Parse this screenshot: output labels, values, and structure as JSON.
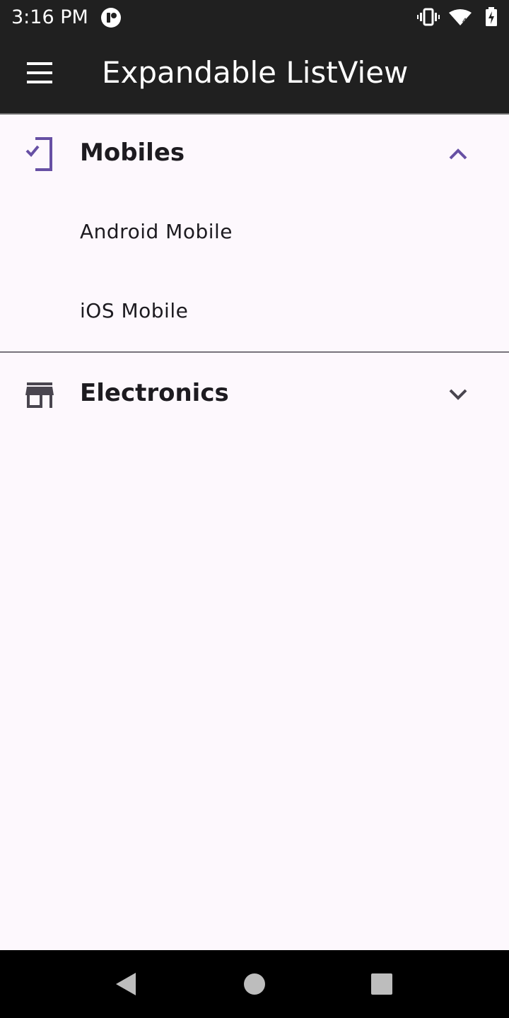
{
  "status_bar": {
    "time": "3:16 PM",
    "signal_badge": "4"
  },
  "app_bar": {
    "title": "Expandable ListView",
    "menu_icon": "menu-icon"
  },
  "groups": [
    {
      "title": "Mobiles",
      "icon": "mobile-check-icon",
      "expanded": true,
      "accent": "#6750a4",
      "children": [
        "Android Mobile",
        "iOS Mobile"
      ]
    },
    {
      "title": "Electronics",
      "icon": "storefront-icon",
      "expanded": false,
      "accent": "#49454f",
      "children": []
    }
  ],
  "navigation": {
    "back_icon": "back-icon",
    "home_icon": "home-icon",
    "recents_icon": "recents-icon"
  },
  "colors": {
    "app_bar_bg": "#202020",
    "background": "#fdf8fd",
    "accent": "#6750a4"
  }
}
